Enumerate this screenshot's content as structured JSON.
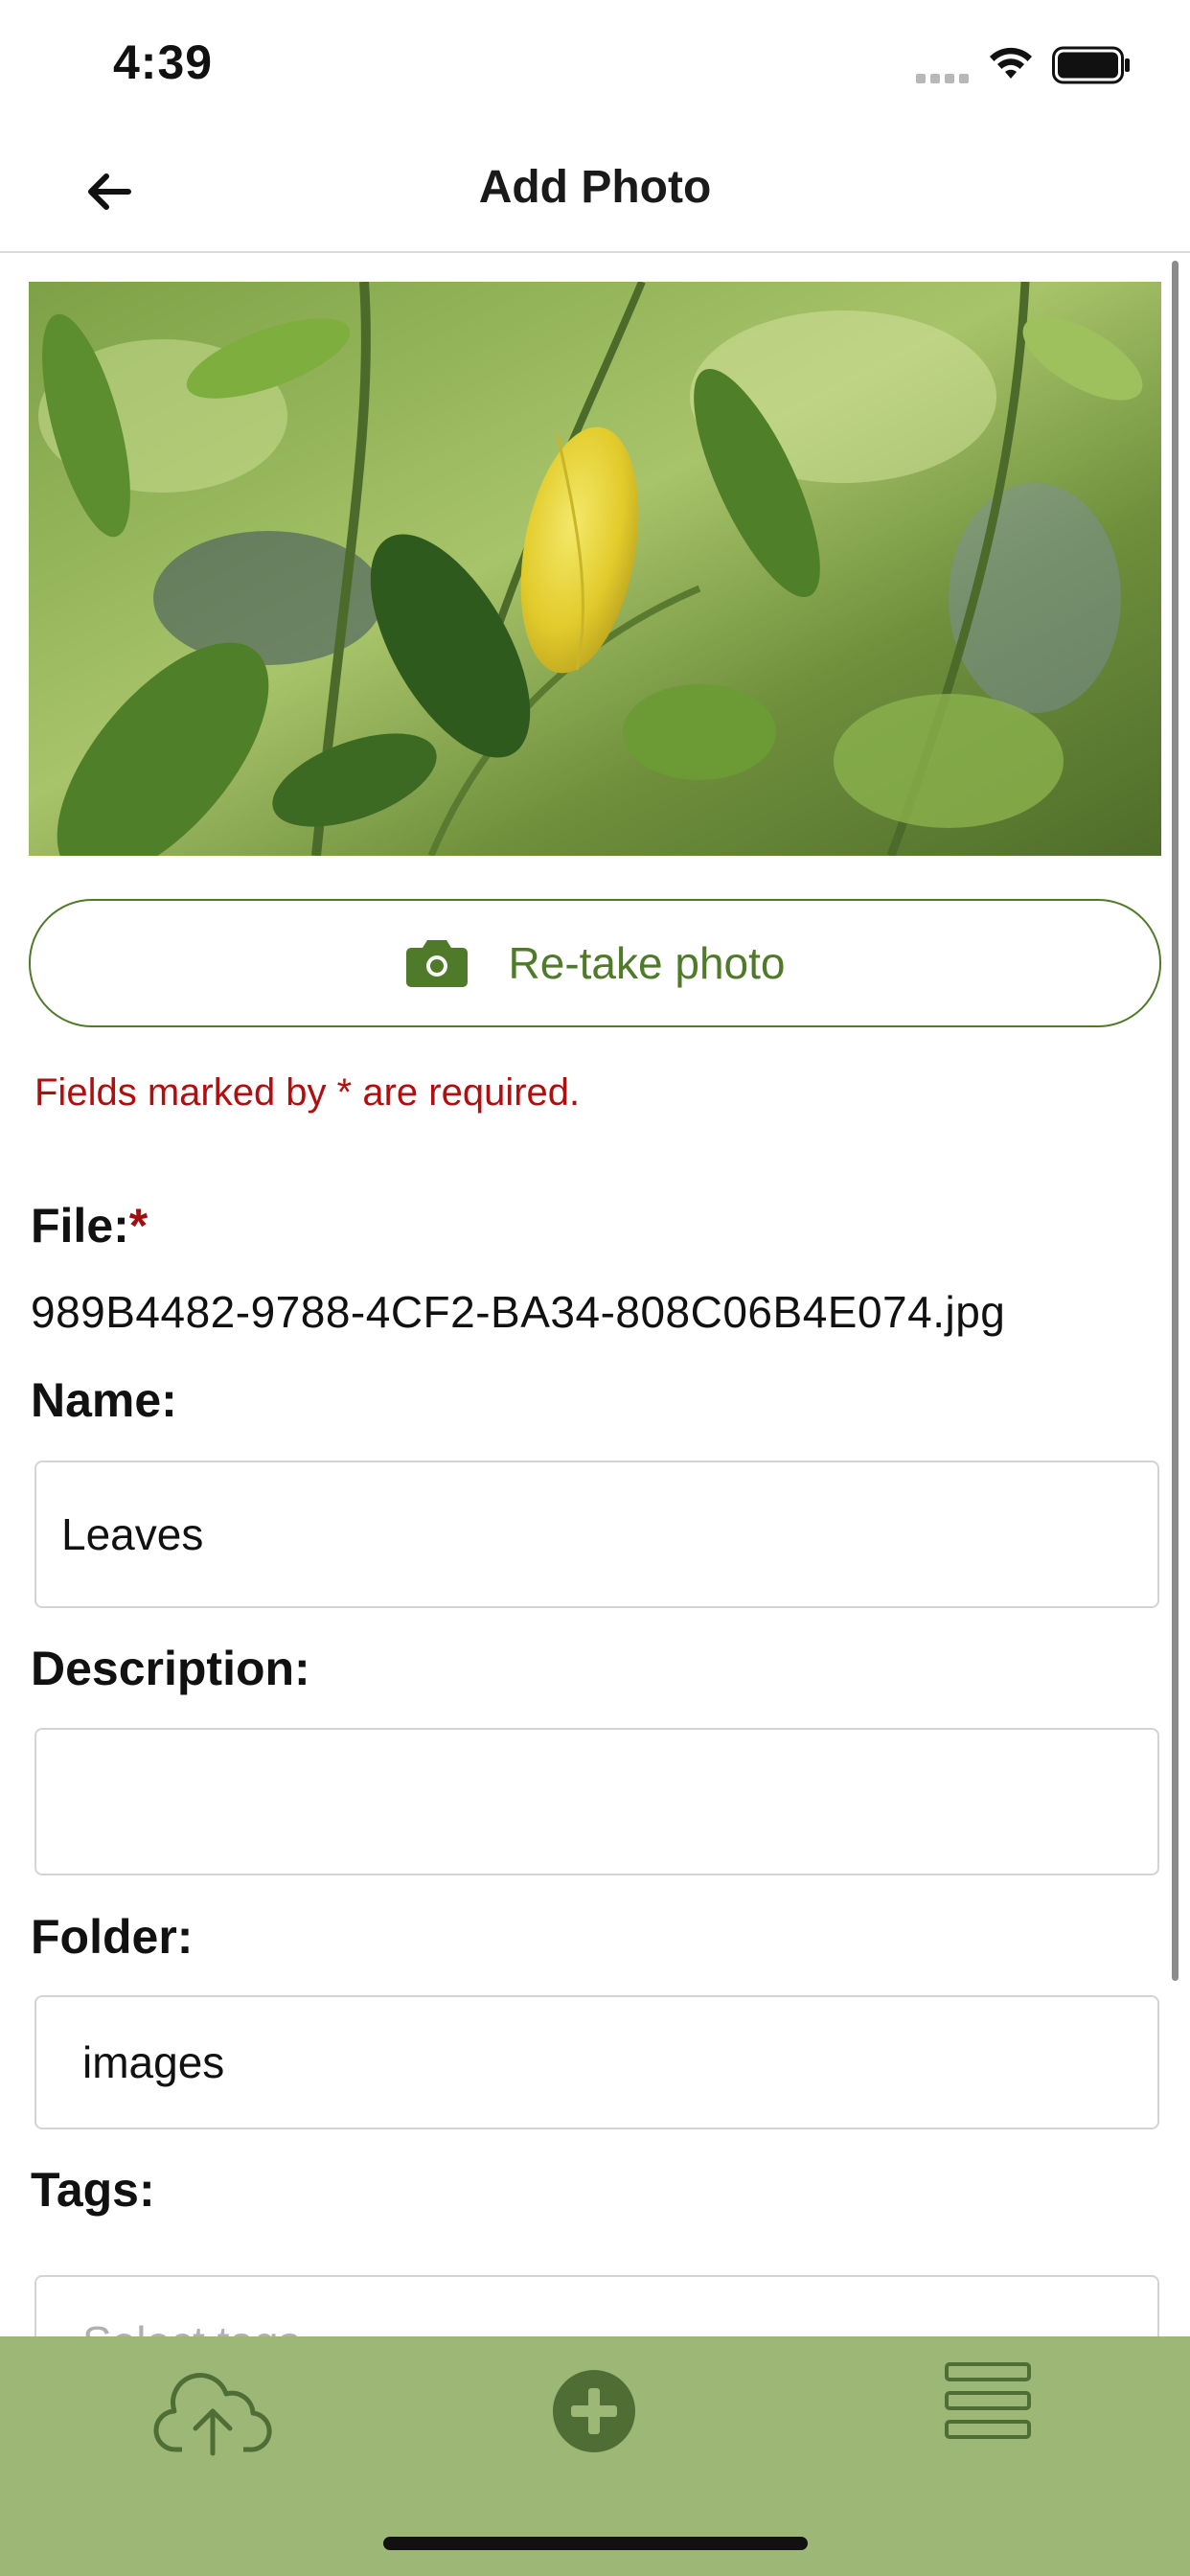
{
  "status_bar": {
    "time": "4:39"
  },
  "nav": {
    "title": "Add Photo",
    "back_icon": "arrow-left-icon"
  },
  "photo": {
    "subject": "green-leaves-with-yellow-leaf"
  },
  "retake": {
    "label": "Re-take photo",
    "icon": "camera-icon"
  },
  "form": {
    "required_note": "Fields marked by * are required.",
    "file": {
      "label": "File:",
      "required_mark": "*",
      "value": "989B4482-9788-4CF2-BA34-808C06B4E074.jpg"
    },
    "name": {
      "label": "Name:",
      "value": "Leaves"
    },
    "description": {
      "label": "Description:",
      "value": ""
    },
    "folder": {
      "label": "Folder:",
      "value": "images"
    },
    "tags": {
      "label": "Tags:",
      "placeholder": "Select tags"
    }
  },
  "tab_bar": {
    "items": [
      {
        "name": "upload",
        "icon": "cloud-upload-icon"
      },
      {
        "name": "add",
        "icon": "plus-circle-icon"
      },
      {
        "name": "menu",
        "icon": "menu-icon"
      }
    ]
  },
  "colors": {
    "accent": "#4f7a2a",
    "tab_bar_bg": "#9db777",
    "tab_icon": "#4f6e35",
    "error": "#b00f0f"
  }
}
